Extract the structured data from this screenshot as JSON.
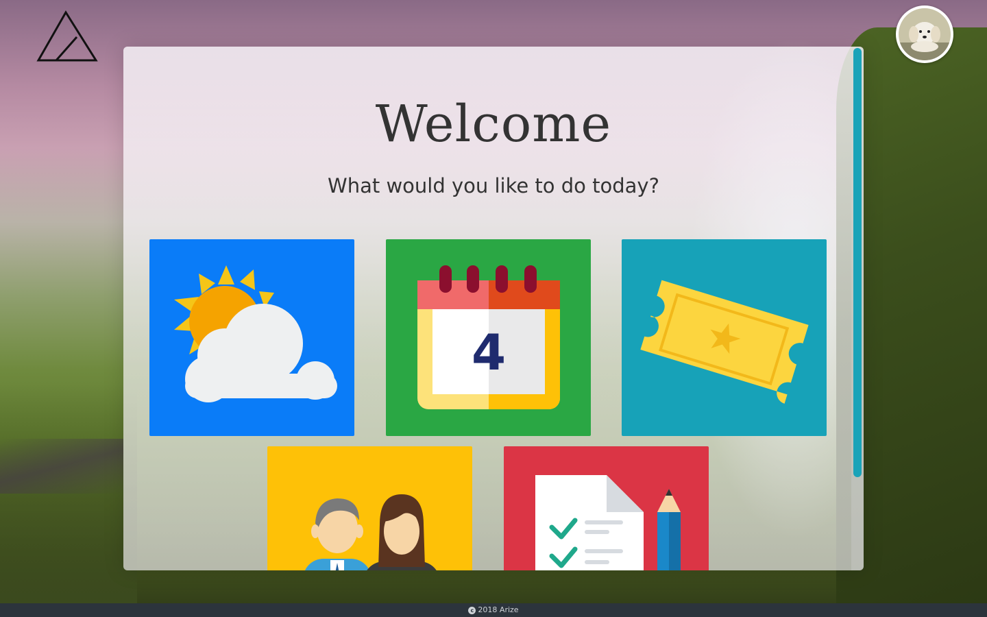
{
  "app": {
    "name": "Arize"
  },
  "header": {
    "logo_icon": "triangle-logo-icon",
    "avatar_icon": "puppy-avatar"
  },
  "main": {
    "title": "Welcome",
    "subtitle": "What would you like to do today?",
    "tiles": [
      {
        "icon": "weather-icon",
        "color": "#0a7cf8"
      },
      {
        "icon": "calendar-icon",
        "color": "#2aa744",
        "calendar_day": "4"
      },
      {
        "icon": "ticket-icon",
        "color": "#17a2b8"
      },
      {
        "icon": "people-icon",
        "color": "#fec107"
      },
      {
        "icon": "checklist-icon",
        "color": "#db3545"
      }
    ]
  },
  "footer": {
    "text": "2018 Arize",
    "icon": "copyright-icon"
  },
  "colors": {
    "scrollbar": "#1aa3b8",
    "footer_bg": "#2c343c"
  }
}
